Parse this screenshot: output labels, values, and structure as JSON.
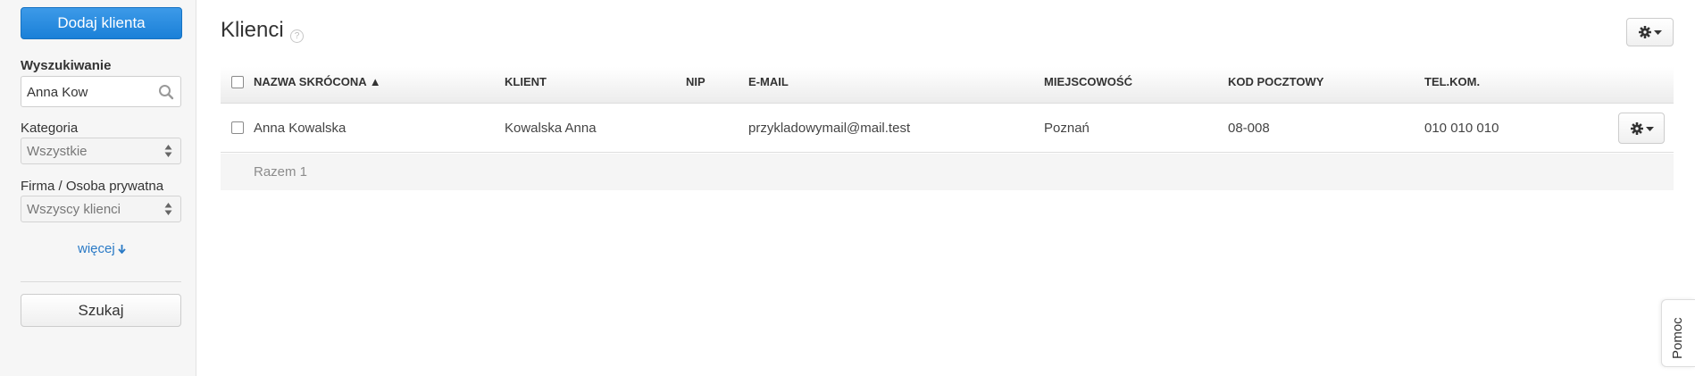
{
  "sidebar": {
    "add_client_label": "Dodaj klienta",
    "search": {
      "label": "Wyszukiwanie",
      "value": "Anna Kow"
    },
    "category": {
      "label": "Kategoria",
      "selected": "Wszystkie"
    },
    "company_type": {
      "label": "Firma / Osoba prywatna",
      "selected": "Wszyscy klienci"
    },
    "more_label": "więcej",
    "search_button_label": "Szukaj"
  },
  "page": {
    "title": "Klienci",
    "help_badge": "?"
  },
  "table": {
    "columns": [
      "NAZWA SKRÓCONA ▲",
      "KLIENT",
      "NIP",
      "E-MAIL",
      "MIEJSCOWOŚĆ",
      "KOD POCZTOWY",
      "TEL.KOM."
    ],
    "rows": [
      {
        "short_name": "Anna Kowalska",
        "client": "Kowalska Anna",
        "nip": "",
        "email": "przykladowymail@mail.test",
        "city": "Poznań",
        "postal_code": "08-008",
        "mobile": "010 010 010"
      }
    ],
    "footer_total": "Razem 1"
  },
  "help_tab_label": "Pomoc",
  "colors": {
    "primary_button": "#1a80d8",
    "link": "#2a7ac6",
    "sidebar_bg": "#f6f6f6"
  },
  "icons": [
    "search-icon",
    "select-arrows-icon",
    "arrow-down-icon",
    "gear-icon",
    "caret-down-icon",
    "help-circle-icon"
  ]
}
